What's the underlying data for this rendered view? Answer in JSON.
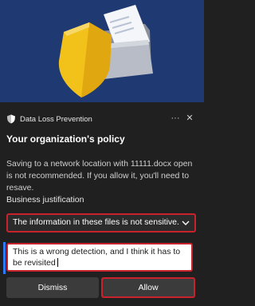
{
  "app": {
    "name": "Data Loss Prevention"
  },
  "dialog": {
    "title": "Your organization's policy",
    "message": "Saving to a network location with 11111.docx open is not recommended. If you allow it, you'll need to resave.",
    "justification_label": "Business justification",
    "justification_selected": "The information in these files is not sensitive.",
    "justification_text": "This is a wrong detection, and I think it has to be revisited",
    "dismiss_label": "Dismiss",
    "allow_label": "Allow"
  },
  "icons": {
    "header_icon": "shield-icon",
    "more": "more-options-icon",
    "close": "close-icon",
    "dropdown": "chevron-down-icon",
    "illustration": "shield-and-folder-illustration"
  },
  "colors": {
    "hero_bg": "#1f3a73",
    "panel_bg": "#202020",
    "highlight_border": "#c8232c",
    "accent_blue": "#2d7cf5",
    "shield_yellow": "#f2c21b"
  }
}
